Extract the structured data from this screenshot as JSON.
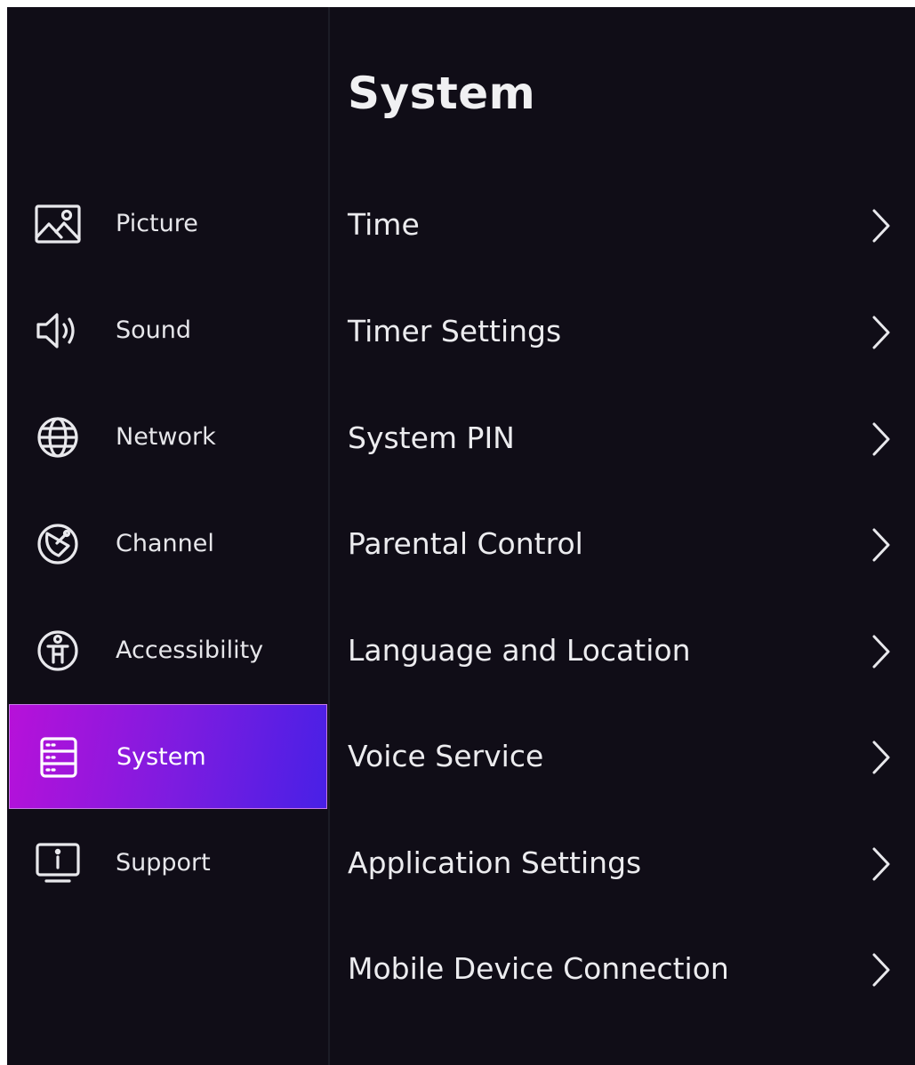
{
  "sidebar": {
    "items": [
      {
        "label": "Picture",
        "icon": "picture-icon"
      },
      {
        "label": "Sound",
        "icon": "speaker-icon"
      },
      {
        "label": "Network",
        "icon": "globe-icon"
      },
      {
        "label": "Channel",
        "icon": "satellite-dish-icon"
      },
      {
        "label": "Accessibility",
        "icon": "accessibility-icon"
      },
      {
        "label": "System",
        "icon": "server-icon",
        "selected": true
      },
      {
        "label": "Support",
        "icon": "info-monitor-icon"
      }
    ],
    "selected_gradient": [
      "#b711d9",
      "#4820e6"
    ]
  },
  "main": {
    "title": "System",
    "items": [
      {
        "label": "Time"
      },
      {
        "label": "Timer Settings"
      },
      {
        "label": "System PIN"
      },
      {
        "label": "Parental Control"
      },
      {
        "label": "Language and Location"
      },
      {
        "label": "Voice Service"
      },
      {
        "label": "Application Settings"
      },
      {
        "label": "Mobile Device Connection"
      }
    ]
  },
  "colors": {
    "background": "#100d17",
    "text": "#e6e6ea"
  }
}
